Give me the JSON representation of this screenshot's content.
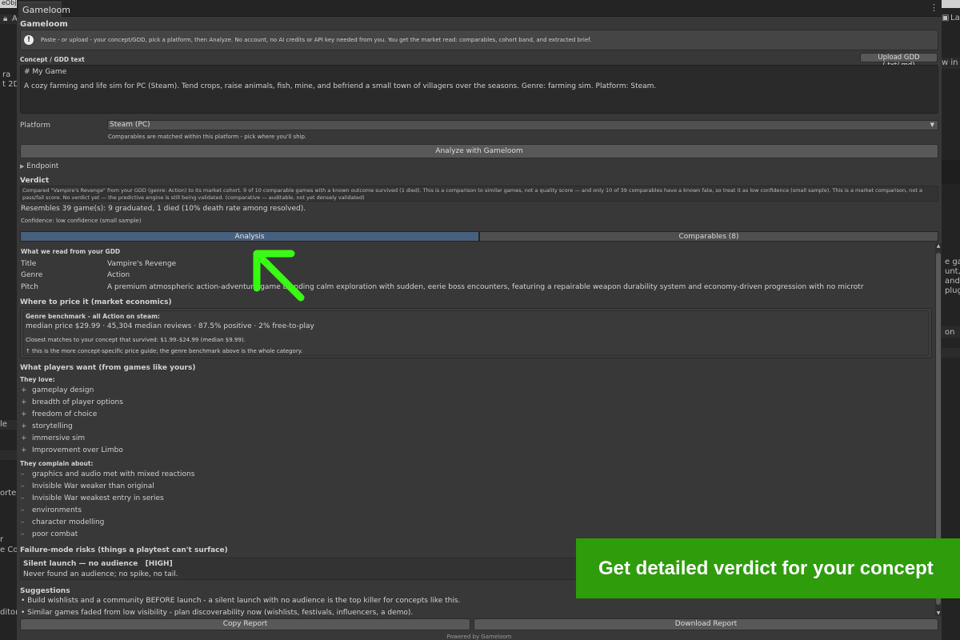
{
  "editor": {
    "top_fragment": "eObje",
    "left_fragments": [
      "A",
      "ra",
      "t 2D",
      "le",
      "orter",
      "r",
      "e Cor",
      "ditor"
    ],
    "right_fragments": [
      "Lay",
      "w in P",
      "e gam",
      "unt, a",
      "and r",
      "plugi",
      "on"
    ]
  },
  "window": {
    "tab_title": "Gameloom",
    "menu_icon": "⋮"
  },
  "header": {
    "title": "Gameloom",
    "info_text": "Paste - or upload - your concept/GDD, pick a platform, then Analyze. No account, no AI credits or API key needed from you. You get the market read: comparables, cohort band, and extracted brief."
  },
  "concept": {
    "label": "Concept / GDD text",
    "upload_label": "Upload GDD (.txt/.md)",
    "line1": "# My Game",
    "line2": "A cozy farming and life sim for PC (Steam). Tend crops, raise animals, fish, mine, and befriend a small town of villagers over the seasons. Genre: farming sim. Platform: Steam."
  },
  "platform": {
    "label": "Platform",
    "selected": "Steam (PC)",
    "hint": "Comparables are matched within this platform - pick where you'll ship."
  },
  "analyze_label": "Analyze with Gameloom",
  "endpoint_label": "Endpoint",
  "verdict": {
    "label": "Verdict",
    "text": "Compared \"Vampire's Revenge\" from your GDD (genre: Action) to its market cohort. 9 of 10 comparable games with a known outcome survived (1 died). This is a comparison to similar games, not a quality score — and only 10 of 39 comparables have a known fate, so treat it as low confidence (small sample). This is a market comparison, not a pass/fail score. No verdict yet — the predictive engine is still being validated. (comparative — auditable, not yet densely validated)",
    "resembles": "Resembles 39 game(s): 9 graduated, 1 died (10% death rate among resolved).",
    "confidence": "Confidence: low confidence (small sample)"
  },
  "tabs": {
    "analysis": "Analysis",
    "comparables": "Comparables (8)"
  },
  "gdd": {
    "heading": "What we read from your GDD",
    "title_key": "Title",
    "title_val": "Vampire's Revenge",
    "genre_key": "Genre",
    "genre_val": "Action",
    "pitch_key": "Pitch",
    "pitch_val": "A premium atmospheric action-adventure game blending calm exploration with sudden, eerie boss encounters, featuring a repairable weapon durability system and economy-driven progression with no microtr"
  },
  "price": {
    "heading": "Where to price it (market economics)",
    "bench_title": "Genre benchmark - all Action on steam:",
    "bench_stats": "median price $29.99   ·   45,304 median reviews   ·   87.5% positive   ·   2% free-to-play",
    "closest": "Closest matches to your concept that survived: $1.99–$24.99 (median $9.99).",
    "note": "↑ this is the more concept-specific price guide; the genre benchmark above is the whole category."
  },
  "players": {
    "heading": "What players want (from games like yours)",
    "love_label": "They love:",
    "loves": [
      "gameplay design",
      "breadth of player options",
      "freedom of choice",
      "storytelling",
      "immersive sim",
      "Improvement over Limbo"
    ],
    "complain_label": "They complain about:",
    "complaints": [
      "graphics and audio met with mixed reactions",
      "Invisible War weaker than original",
      "Invisible War weakest entry in series",
      "environments",
      "character modelling",
      "poor combat"
    ]
  },
  "risks": {
    "heading": "Failure-mode risks (things a playtest can't surface)",
    "item_title": "Silent launch — no audience",
    "item_level": "[HIGH]",
    "item_desc": "Never found an audience; no spike, no tail."
  },
  "suggestions": {
    "heading": "Suggestions",
    "items": [
      "• Build wishlists and a community BEFORE launch - a silent launch with no audience is the top killer for concepts like this.",
      "• Similar games faded from low visibility - plan discoverability now (wishlists, festivals, influencers, a demo)."
    ]
  },
  "buttons": {
    "copy": "Copy Report",
    "download": "Download Report"
  },
  "footer": "Powered by Gameloom",
  "banner": {
    "text": "Get detailed verdict for your concept",
    "color": "#2e9c0b"
  },
  "arrow_color": "#39ff14"
}
